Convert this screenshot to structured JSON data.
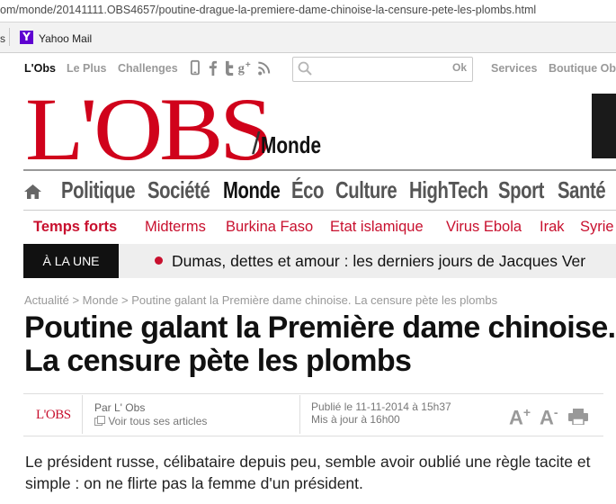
{
  "browser": {
    "url": "om/monde/20141111.OBS4657/poutine-drague-la-premiere-dame-chinoise-la-censure-pete-les-plombs.html",
    "bookmarks_left": "s",
    "bookmark": {
      "label": "Yahoo Mail",
      "icon": "yahoo-icon"
    }
  },
  "topbar": {
    "links": [
      "L'Obs",
      "Le Plus",
      "Challenges"
    ],
    "social_icons": [
      "mobile-icon",
      "facebook-icon",
      "twitter-icon",
      "google-plus-icon",
      "rss-icon"
    ],
    "search": {
      "placeholder": "",
      "button": "Ok"
    },
    "services": "Services",
    "shop": "Boutique Obs"
  },
  "logo": {
    "text": "L'OBS",
    "section": "Monde",
    "color": "#d0021b"
  },
  "main_nav": [
    "Politique",
    "Société",
    "Monde",
    "Éco",
    "Culture",
    "HighTech",
    "Sport",
    "Santé"
  ],
  "main_nav_active": "Monde",
  "hot_topics": {
    "lead": "Temps forts",
    "items": [
      "Midterms",
      "Burkina Faso",
      "Etat islamique",
      "Virus Ebola",
      "Irak",
      "Syrie"
    ]
  },
  "alune": {
    "label": "À LA UNE",
    "headline": "Dumas, dettes et amour : les derniers jours de Jacques Ver"
  },
  "breadcrumb": "Actualité > Monde > Poutine galant la Première dame chinoise. La censure pète les plombs",
  "article": {
    "title": "Poutine galant la Première dame chinoise. La censure pète les plombs",
    "byline": {
      "logo": "L'OBS",
      "author": "Par L' Obs",
      "author_link": "Voir tous ses articles",
      "published": "Publié le 11-11-2014 à 15h37",
      "updated": "Mis à jour à 16h00"
    },
    "tools": {
      "font_up": "A",
      "font_down": "A",
      "print_icon": "printer-icon"
    },
    "lead": "Le président russe, célibataire depuis peu, semble avoir oublié une règle tacite et simple : on ne flirte pas la femme d'un président."
  },
  "colors": {
    "brand_red": "#d0021b",
    "hot_red": "#c8102e",
    "alune_bg": "#111111"
  }
}
